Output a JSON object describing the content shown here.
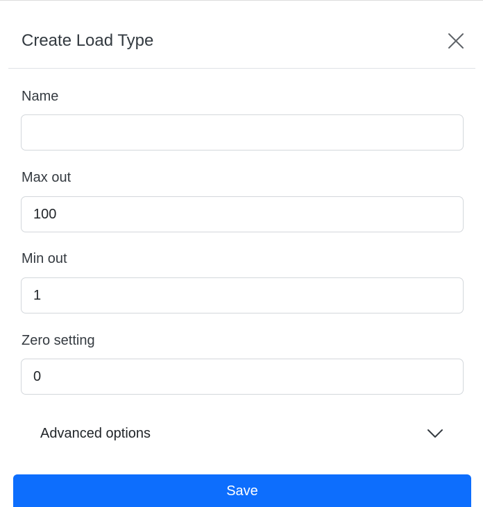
{
  "dialog": {
    "title": "Create Load Type",
    "close_icon": "close-icon"
  },
  "fields": {
    "name": {
      "label": "Name",
      "value": "",
      "placeholder": ""
    },
    "max_out": {
      "label": "Max out",
      "value": "100"
    },
    "min_out": {
      "label": "Min out",
      "value": "1"
    },
    "zero_setting": {
      "label": "Zero setting",
      "value": "0"
    }
  },
  "advanced": {
    "label": "Advanced options",
    "icon": "chevron-down-icon"
  },
  "actions": {
    "save_label": "Save"
  },
  "colors": {
    "primary": "#0d6efd",
    "border": "#d3d7db",
    "divider": "#dee2e6"
  }
}
